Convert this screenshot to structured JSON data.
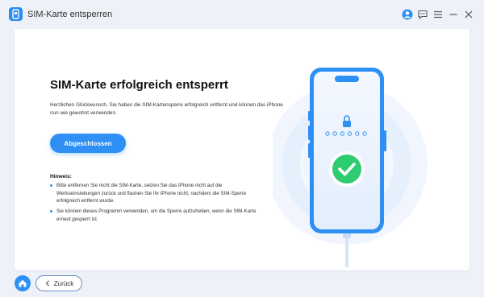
{
  "window": {
    "title": "SIM-Karte entsperren",
    "controls": [
      "account-icon",
      "feedback-icon",
      "menu-icon",
      "minimize-icon",
      "close-icon"
    ]
  },
  "main": {
    "heading": "SIM-Karte erfolgreich entsperrt",
    "description": "Herzlichen Glückwunsch, Sie haben die SIM-Kartensperre erfolgreich entfernt und können das iPhone nun wie gewohnt verwenden.",
    "primary_button": "Abgeschlossen",
    "hint_title": "Hinweis:",
    "hints": [
      "Bitte entfernen Sie nicht die SIM-Karte, setzen Sie das iPhone nicht auf die Werkseinstellungen zurück und flashen Sie Ihr iPhone nicht, nachdem die SIM-Sperre erfolgreich entfernt wurde.",
      "Sie können dieses Programm verwenden, um die Sperre aufzuheben, wenn die SIM-Karte erneut gesperrt ist."
    ]
  },
  "footer": {
    "back_label": "Zurück"
  },
  "colors": {
    "accent": "#2e8ff5",
    "success": "#2ecc71",
    "background": "#eef2f8"
  }
}
